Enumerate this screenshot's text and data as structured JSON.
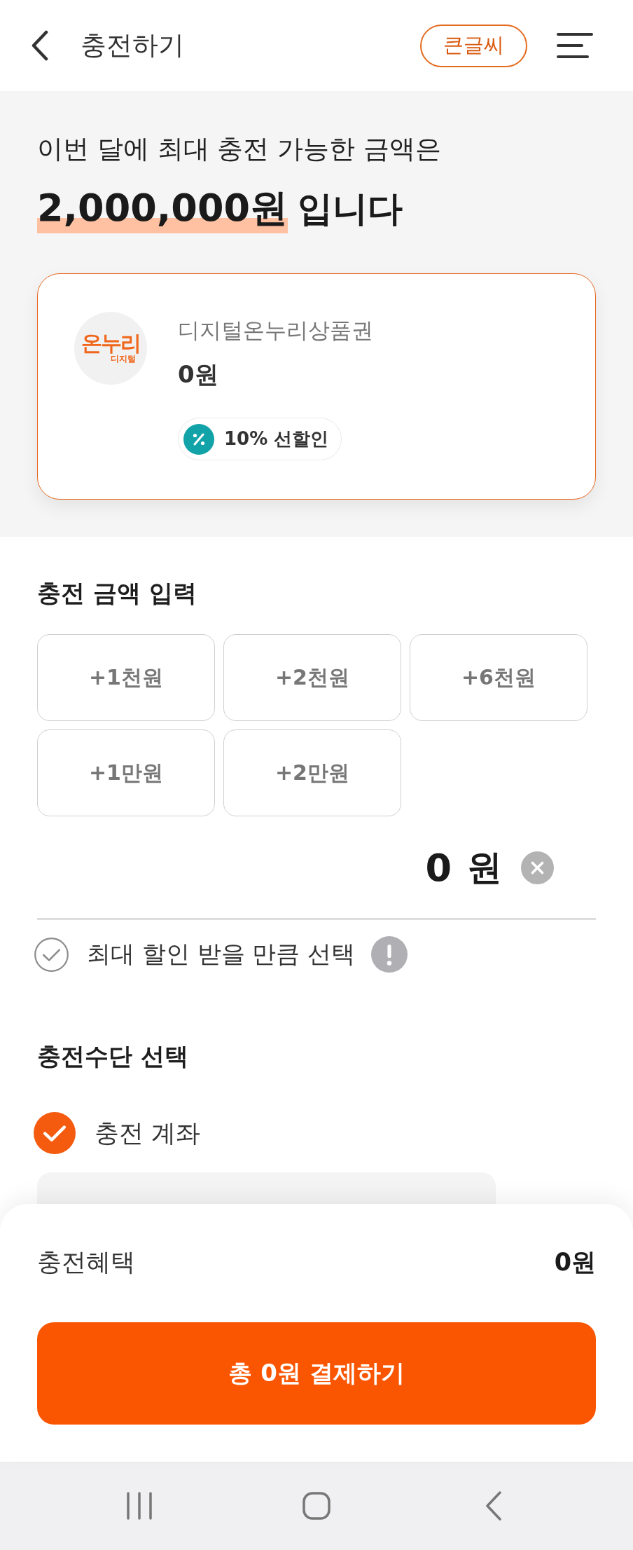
{
  "header": {
    "title": "충전하기",
    "large_text_button": "큰글씨"
  },
  "limit": {
    "intro": "이번 달에 최대 충전 가능한 금액은",
    "amount": "2,000,000원",
    "suffix": "입니다"
  },
  "voucher_card": {
    "selected": true,
    "logo_text": "온누리",
    "logo_subtext": "디지털",
    "name": "디지털온누리상품권",
    "balance": "0원",
    "badge": "10% 선할인"
  },
  "amount_input": {
    "title": "충전 금액 입력",
    "quick_buttons": [
      "+1천원",
      "+2천원",
      "+6천원",
      "+1만원",
      "+2만원"
    ],
    "value": "0",
    "unit": "원",
    "max_discount": {
      "label": "최대 할인 받을 만큼 선택",
      "checked": false
    }
  },
  "payment_method": {
    "title": "충전수단 선택",
    "options": [
      {
        "label": "충전 계좌",
        "selected": true
      }
    ]
  },
  "summary": {
    "benefit_label": "충전혜택",
    "benefit_value": "0원",
    "pay_button": "총 0원 결제하기"
  }
}
